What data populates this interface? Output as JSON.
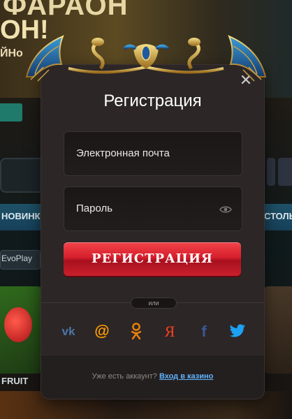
{
  "background": {
    "banner_title_line1": "ФАРАОН",
    "banner_title_line2": "ОН!",
    "banner_sub": "ЙНо",
    "nav_left": "НОВИНК",
    "nav_right": "СТОЛЬ",
    "provider_chip": "EvoPlay",
    "game_card_label": "FRUIT"
  },
  "modal": {
    "title": "Регистрация",
    "close_icon": "close-icon",
    "email_placeholder": "Электронная почта",
    "password_placeholder": "Пароль",
    "password_icon": "eye-icon",
    "register_button": "РЕГИСТРАЦИЯ",
    "divider_text": "или",
    "socials": [
      {
        "name": "vk-icon",
        "color": "#4a76a8"
      },
      {
        "name": "mailru-icon",
        "color": "#ff9e00"
      },
      {
        "name": "odnoklassniki-icon",
        "color": "#ee8208"
      },
      {
        "name": "yandex-icon",
        "color": "#fc3f1d"
      },
      {
        "name": "facebook-icon",
        "color": "#3b5998"
      },
      {
        "name": "twitter-icon",
        "color": "#1da1f2"
      }
    ],
    "footer_question": "Уже есть аккаунт?",
    "footer_link": "Вход в казино"
  },
  "colors": {
    "modal_bg": "#2c2626",
    "accent_red": "#d61f2c",
    "link_blue": "#5fb3ff"
  }
}
